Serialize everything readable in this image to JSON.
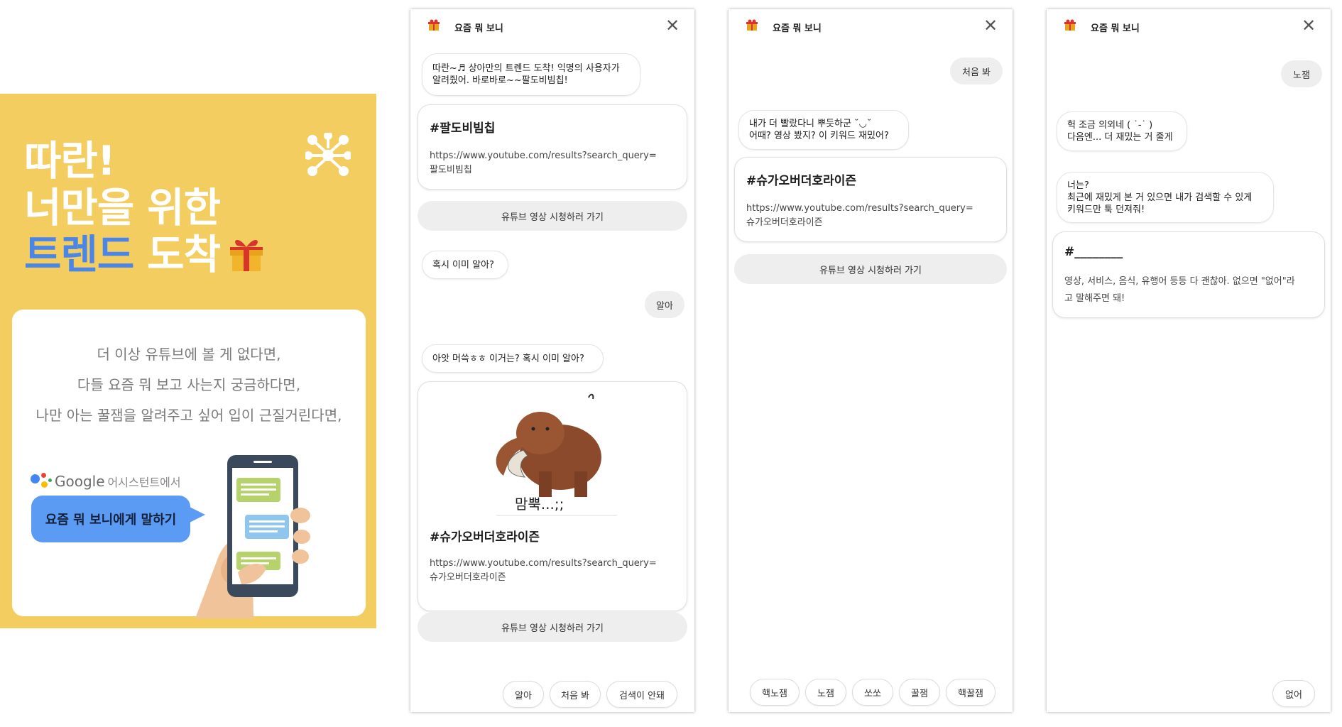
{
  "promo": {
    "title_line1": "따란!",
    "title_line2": "너만을 위한",
    "title_line3_accent": "트렌드",
    "title_line3_rest": " 도착",
    "lines": [
      "더 이상 유튜브에 볼 게 없다면,",
      "다들 요즘 뭐 보고 사는지 궁금하다면,",
      "나만 아는 꿀잼을 알려주고 싶어 입이 근질거린다면,"
    ],
    "google_brand": "Google",
    "google_suffix": "어시스턴트에서",
    "speak_label": "요즘 뭐 보니에게 말하기"
  },
  "screen1": {
    "title": "요즘 뭐 보니",
    "bot_msg1": "따란~♬ 상아만의 트렌드 도착! 익명의 사용자가\n알려줬어. 바로바로~~팔도비빔칩!",
    "card1_title": "#팔도비빔칩",
    "card1_url": "https://www.youtube.com/results?search_query=\n팔도비빔칩",
    "watch_label": "유튜브 영상 시청하러 가기",
    "bot_msg2": "혹시 이미 알아?",
    "user_msg1": "알아",
    "bot_msg3": "아앗 머쓱ㅎㅎ 이거는? 혹시 이미 알아?",
    "sticker_text": "맘뿍...;;",
    "card2_title": "#슈가오버더호라이즌",
    "card2_url": "https://www.youtube.com/results?search_query=\n슈가오버더호라이즌",
    "watch_label2": "유튜브 영상 시청하러 가기",
    "chips": [
      "알아",
      "처음 봐",
      "검색이 안돼"
    ]
  },
  "screen2": {
    "title": "요즘 뭐 보니",
    "user_msg": "처음 봐",
    "bot_msg": "내가 더 빨랐다니 뿌듯하군 ˘◡˘\n어때? 영상 봤지? 이 키워드 재밌어?",
    "card_title": "#슈가오버더호라이즌",
    "card_url": "https://www.youtube.com/results?search_query=\n슈가오버더호라이즌",
    "watch_label": "유튜브 영상 시청하러 가기",
    "chips": [
      "핵노잼",
      "노잼",
      "쏘쏘",
      "꿀잼",
      "핵꿀잼"
    ]
  },
  "screen3": {
    "title": "요즘 뭐 보니",
    "user_msg": "노잼",
    "bot_msg1": "헉 조금 의외네 ( ˙-˙ )\n다음엔... 더 재밌는 거 줄게",
    "bot_msg2": "너는?\n최근에 재밌게 본 거 있으면 내가 검색할 수 있게\n키워드만 툭 던져줘!",
    "card_title": "#________",
    "card_body": "영상, 서비스, 음식, 유행어 등등 다 괜찮아.  없으면 \"없어\"라\n고 말해주면 돼!",
    "chips": [
      "없어"
    ]
  },
  "colors": {
    "promo_bg": "#f4cd61",
    "accent_blue": "#4a86e8",
    "speak_bubble": "#5b9bf3",
    "button_gray": "#eeeeee"
  }
}
